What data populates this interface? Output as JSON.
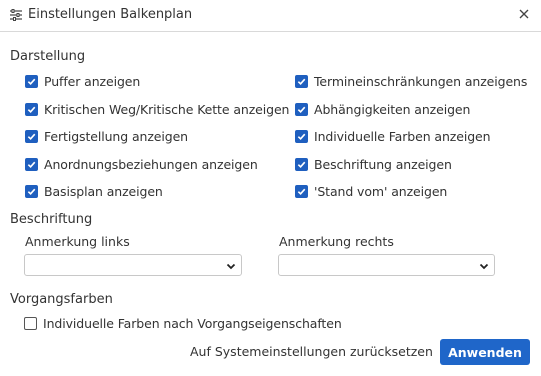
{
  "dialog": {
    "title": "Einstellungen Balkenplan",
    "title_icon": "sliders-icon",
    "close_icon": "close-icon"
  },
  "display": {
    "heading": "Darstellung",
    "left": [
      {
        "label": "Puffer anzeigen",
        "checked": true
      },
      {
        "label": "Kritischen Weg/Kritische Kette anzeigen",
        "checked": true
      },
      {
        "label": "Fertigstellung anzeigen",
        "checked": true
      },
      {
        "label": "Anordnungsbeziehungen anzeigen",
        "checked": true
      },
      {
        "label": "Basisplan anzeigen",
        "checked": true
      }
    ],
    "right": [
      {
        "label": "Termineinschränkungen anzeigens",
        "checked": true
      },
      {
        "label": "Abhängigkeiten anzeigen",
        "checked": true
      },
      {
        "label": "Individuelle Farben anzeigen",
        "checked": true
      },
      {
        "label": "Beschriftung anzeigen",
        "checked": true
      },
      {
        "label": "'Stand vom' anzeigen",
        "checked": true
      }
    ]
  },
  "labeling": {
    "heading": "Beschriftung",
    "left_label": "Anmerkung links",
    "left_value": "",
    "right_label": "Anmerkung rechts",
    "right_value": ""
  },
  "colors": {
    "heading": "Vorgangsfarben",
    "option": {
      "label": "Individuelle Farben nach Vorgangseigenschaften",
      "checked": false
    }
  },
  "footer": {
    "reset_label": "Auf Systemeinstellungen zurücksetzen",
    "apply_label": "Anwenden"
  },
  "theme": {
    "accent": "#1f66c9",
    "checkbox": "#1f5fbf"
  }
}
